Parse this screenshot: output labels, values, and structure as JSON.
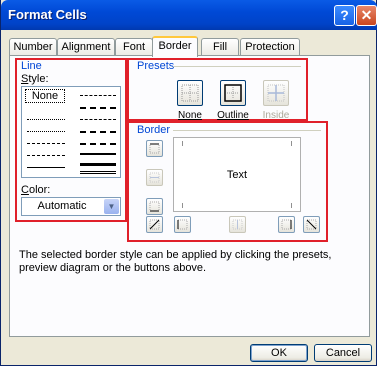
{
  "window": {
    "title": "Format Cells",
    "help_label": "?",
    "close_label": "✕"
  },
  "tabs": [
    "Number",
    "Alignment",
    "Font",
    "Border",
    "Fill",
    "Protection"
  ],
  "line": {
    "title": "Line",
    "style_label": "Style:",
    "none_label": "None",
    "color_label": "Color:",
    "color_value": "Automatic"
  },
  "presets": {
    "title": "Presets",
    "items": [
      {
        "label": "None",
        "icon": "preset-none-icon",
        "enabled": true
      },
      {
        "label": "Outline",
        "icon": "preset-outline-icon",
        "enabled": true
      },
      {
        "label": "Inside",
        "icon": "preset-inside-icon",
        "enabled": false
      }
    ]
  },
  "border": {
    "title": "Border",
    "preview_text": "Text"
  },
  "hint": "The selected border style can be applied by clicking the presets, preview diagram or the buttons above.",
  "buttons": {
    "ok": "OK",
    "cancel": "Cancel"
  },
  "colors": {
    "accent_red": "#E0202A",
    "group_title": "#0046D5",
    "dialog_bg": "#ECE9D8"
  }
}
